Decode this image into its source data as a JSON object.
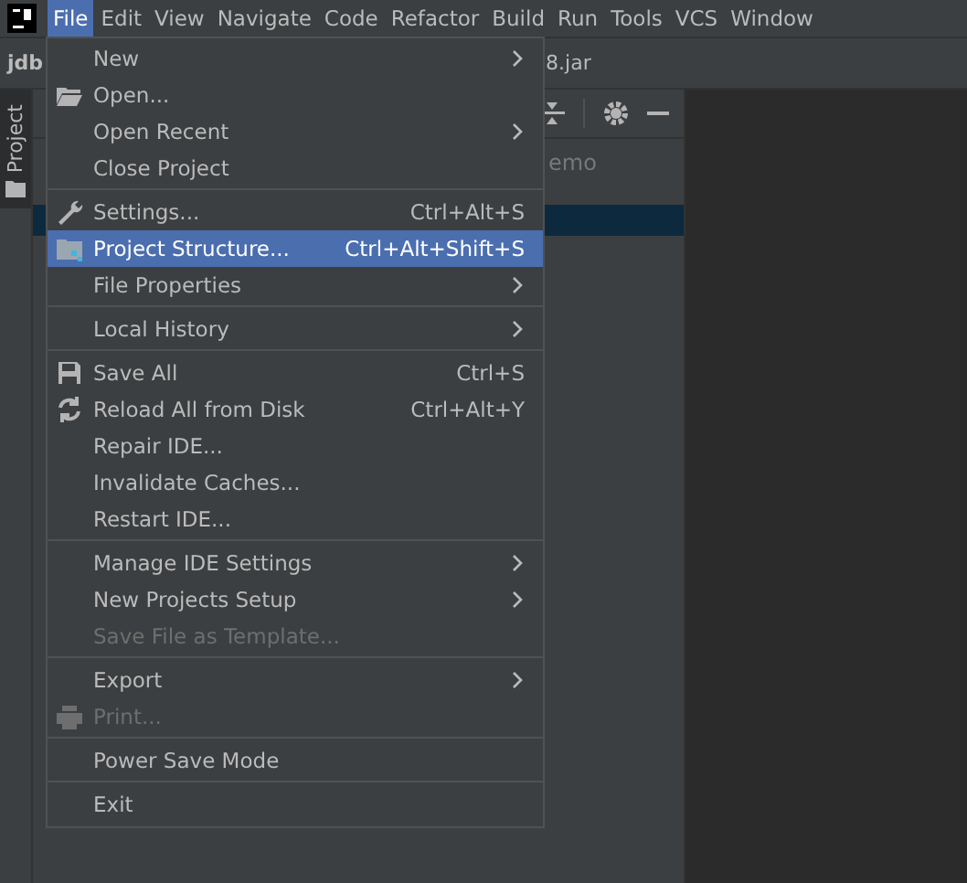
{
  "menu_bar": [
    {
      "label": "File",
      "selected": true
    },
    {
      "label": "Edit",
      "selected": false
    },
    {
      "label": "View",
      "selected": false
    },
    {
      "label": "Navigate",
      "selected": false
    },
    {
      "label": "Code",
      "selected": false
    },
    {
      "label": "Refactor",
      "selected": false
    },
    {
      "label": "Build",
      "selected": false
    },
    {
      "label": "Run",
      "selected": false
    },
    {
      "label": "Tools",
      "selected": false
    },
    {
      "label": "VCS",
      "selected": false
    },
    {
      "label": "Window",
      "selected": false
    }
  ],
  "breadcrumbs": [
    "jdb",
    "8.jar"
  ],
  "side_tab": {
    "label": "Project",
    "selected": true
  },
  "project_panel": {
    "text": "emo"
  },
  "file_menu": [
    {
      "kind": "item",
      "label": "New",
      "submenu": true,
      "disabled": false,
      "selected": false
    },
    {
      "kind": "item",
      "label": "Open...",
      "submenu": false,
      "disabled": false,
      "selected": false
    },
    {
      "kind": "item",
      "label": "Open Recent",
      "submenu": true,
      "disabled": false,
      "selected": false
    },
    {
      "kind": "item",
      "label": "Close Project",
      "submenu": false,
      "disabled": false,
      "selected": false
    },
    {
      "kind": "separator"
    },
    {
      "kind": "item",
      "label": "Settings...",
      "shortcut": "Ctrl+Alt+S",
      "submenu": false,
      "disabled": false,
      "selected": false
    },
    {
      "kind": "item",
      "label": "Project Structure...",
      "shortcut": "Ctrl+Alt+Shift+S",
      "submenu": false,
      "disabled": false,
      "selected": true
    },
    {
      "kind": "item",
      "label": "File Properties",
      "submenu": true,
      "disabled": false,
      "selected": false
    },
    {
      "kind": "separator"
    },
    {
      "kind": "item",
      "label": "Local History",
      "submenu": true,
      "disabled": false,
      "selected": false
    },
    {
      "kind": "separator"
    },
    {
      "kind": "item",
      "label": "Save All",
      "shortcut": "Ctrl+S",
      "submenu": false,
      "disabled": false,
      "selected": false
    },
    {
      "kind": "item",
      "label": "Reload All from Disk",
      "shortcut": "Ctrl+Alt+Y",
      "submenu": false,
      "disabled": false,
      "selected": false
    },
    {
      "kind": "item",
      "label": "Repair IDE...",
      "submenu": false,
      "disabled": false,
      "selected": false
    },
    {
      "kind": "item",
      "label": "Invalidate Caches...",
      "submenu": false,
      "disabled": false,
      "selected": false
    },
    {
      "kind": "item",
      "label": "Restart IDE...",
      "submenu": false,
      "disabled": false,
      "selected": false
    },
    {
      "kind": "separator"
    },
    {
      "kind": "item",
      "label": "Manage IDE Settings",
      "submenu": true,
      "disabled": false,
      "selected": false
    },
    {
      "kind": "item",
      "label": "New Projects Setup",
      "submenu": true,
      "disabled": false,
      "selected": false
    },
    {
      "kind": "item",
      "label": "Save File as Template...",
      "submenu": false,
      "disabled": true,
      "selected": false
    },
    {
      "kind": "separator"
    },
    {
      "kind": "item",
      "label": "Export",
      "submenu": true,
      "disabled": false,
      "selected": false
    },
    {
      "kind": "item",
      "label": "Print...",
      "submenu": false,
      "disabled": true,
      "selected": false
    },
    {
      "kind": "separator"
    },
    {
      "kind": "item",
      "label": "Power Save Mode",
      "submenu": false,
      "disabled": false,
      "selected": false
    },
    {
      "kind": "separator"
    },
    {
      "kind": "item",
      "label": "Exit",
      "submenu": false,
      "disabled": false,
      "selected": false
    }
  ]
}
